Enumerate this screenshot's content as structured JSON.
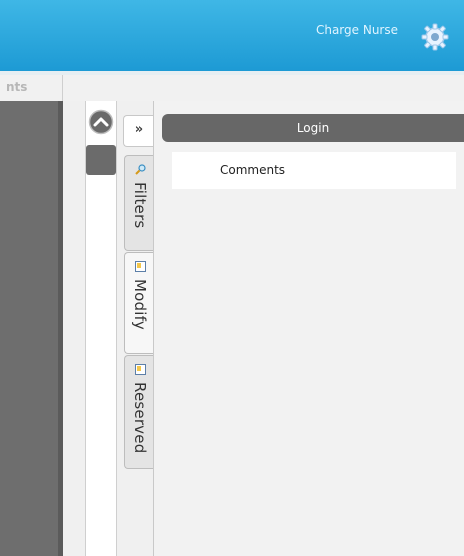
{
  "header": {
    "role": "Charge Nurse",
    "settings_icon": "gear-icon"
  },
  "colbar": {
    "partial_heading": "nts"
  },
  "sidebar": {
    "up_icon": "chevron-up-icon",
    "expand_label": "»",
    "tabs": [
      {
        "label": "Filters",
        "icon": "search-icon"
      },
      {
        "label": "Modify",
        "icon": "document-icon"
      },
      {
        "label": "Reserved",
        "icon": "document-icon"
      }
    ]
  },
  "main": {
    "login_label": "Login",
    "comments_label": "Comments"
  },
  "colors": {
    "header": "#1d9ad4",
    "dark_panel": "#6e6e6e",
    "button": "#676767"
  }
}
